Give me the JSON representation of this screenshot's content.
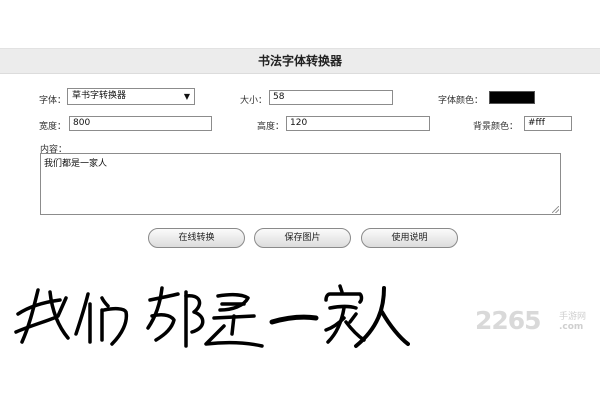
{
  "header": {
    "title": "书法字体转换器"
  },
  "form": {
    "font_label": "字体：",
    "font_value": "草书字转换器",
    "size_label": "大小：",
    "size_value": "58",
    "font_color_label": "字体颜色：",
    "font_color_value": "#000000",
    "width_label": "宽度：",
    "width_value": "800",
    "height_label": "高度：",
    "height_value": "120",
    "bg_color_label": "背景颜色：",
    "bg_color_value": "#fff",
    "content_label": "内容：",
    "content_value": "我们都是一家人"
  },
  "buttons": {
    "convert": "在线转换",
    "save": "保存图片",
    "help": "使用说明"
  },
  "preview": {
    "text": "我们都是一家人",
    "ink_color": "#000000"
  },
  "watermark": {
    "number": "2265",
    "brand_cn": "手游网",
    "domain": ".com"
  }
}
